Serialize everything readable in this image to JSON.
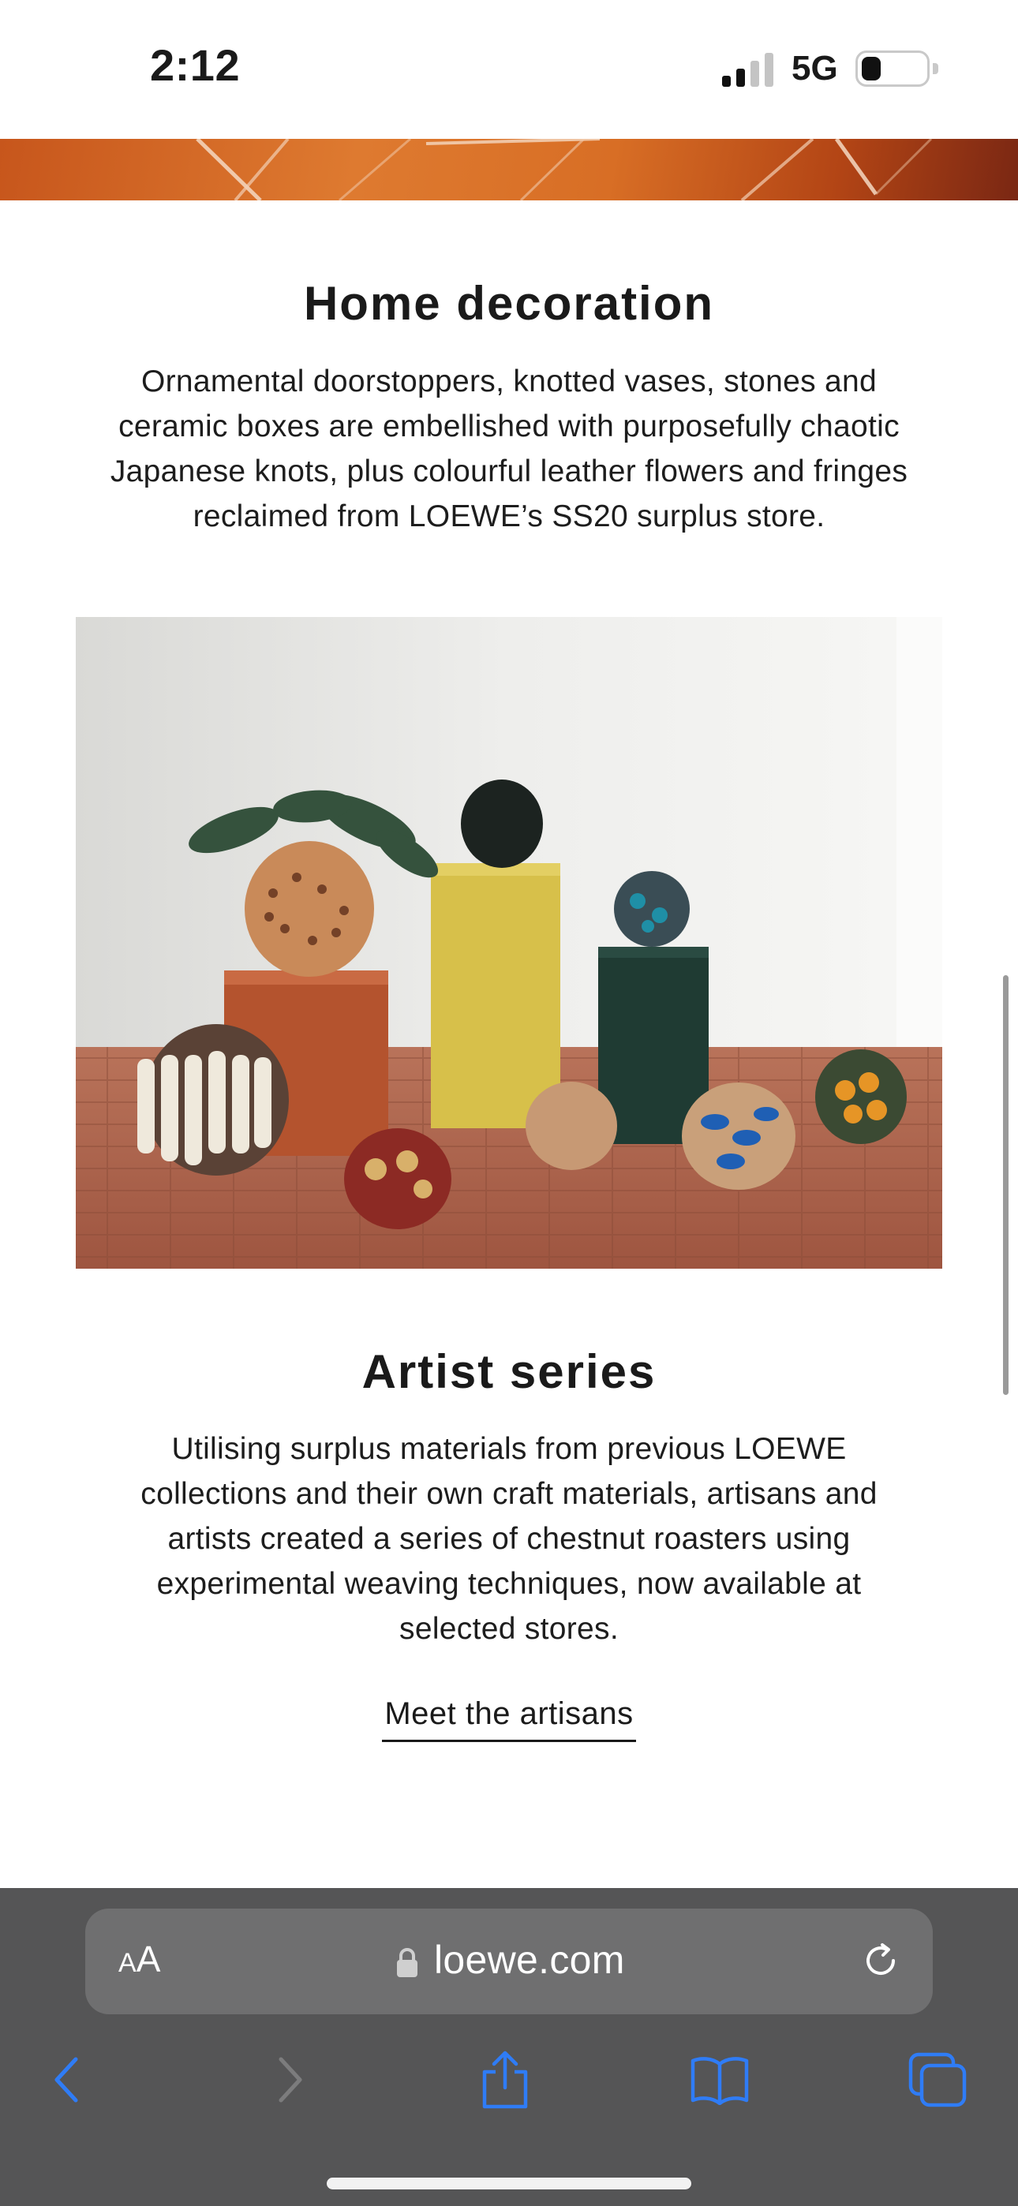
{
  "status": {
    "time": "2:12",
    "network": "5G"
  },
  "sections": [
    {
      "title": "Home decoration",
      "body_lines": [
        "Ornamental doorstoppers, knotted vases, stones and",
        "ceramic boxes are embellished with purposefully chaotic",
        "Japanese knots, plus colourful leather flowers and fringes",
        "reclaimed from LOEWE’s SS20 surplus store."
      ]
    },
    {
      "title": "Artist series",
      "body_lines": [
        "Utilising surplus materials from previous LOEWE",
        "collections and their own craft materials, artisans and",
        "artists created a series of chestnut roasters using",
        "experimental weaving techniques, now available at",
        "selected stores."
      ],
      "link": "Meet the artisans"
    }
  ],
  "browser": {
    "text_size_small": "A",
    "text_size_large": "A",
    "url": "loewe.com",
    "accent_color": "#2f7cf6"
  }
}
